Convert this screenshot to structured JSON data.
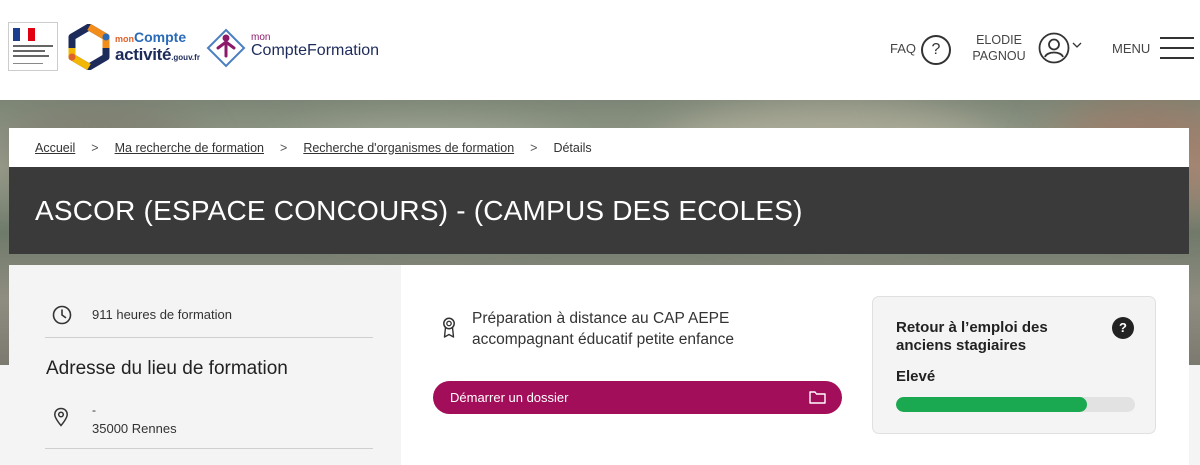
{
  "header": {
    "faq_label": "FAQ",
    "faq_icon_glyph": "?",
    "user_first": "ELODIE",
    "user_last": "PAGNOU",
    "menu_label": "MENU",
    "logo_mca": {
      "mon": "mon",
      "compte": "Compte",
      "activite": "activité",
      "gouv": ".gouv.fr"
    },
    "logo_mcf": {
      "mon": "mon",
      "name": "CompteFormation"
    }
  },
  "breadcrumb": {
    "items": [
      "Accueil",
      "Ma recherche de formation",
      "Recherche d'organismes de formation"
    ],
    "current": "Détails",
    "separator": ">"
  },
  "title": "ASCOR (ESPACE CONCOURS) - (CAMPUS DES ECOLES)",
  "left_panel": {
    "hours": "911 heures de formation",
    "address_title": "Adresse du lieu de formation",
    "address_line1": "-",
    "address_line2": "35000 Rennes"
  },
  "main": {
    "course_title": "Préparation à distance au CAP AEPE accompagnant éducatif petite enfance",
    "start_button": "Démarrer un dossier",
    "stat_card": {
      "title": "Retour à l’emploi des anciens stagiaires",
      "help_glyph": "?",
      "level": "Elevé",
      "progress_fraction": 0.8
    }
  },
  "colors": {
    "accent": "#a30e5a",
    "progress": "#1aa851",
    "title_band": "#3a3a3a",
    "navy": "#1d2b5b"
  },
  "icons": [
    "clock-icon",
    "location-pin-icon",
    "ribbon-award-icon",
    "folder-icon",
    "user-icon",
    "help-icon",
    "menu-icon"
  ]
}
